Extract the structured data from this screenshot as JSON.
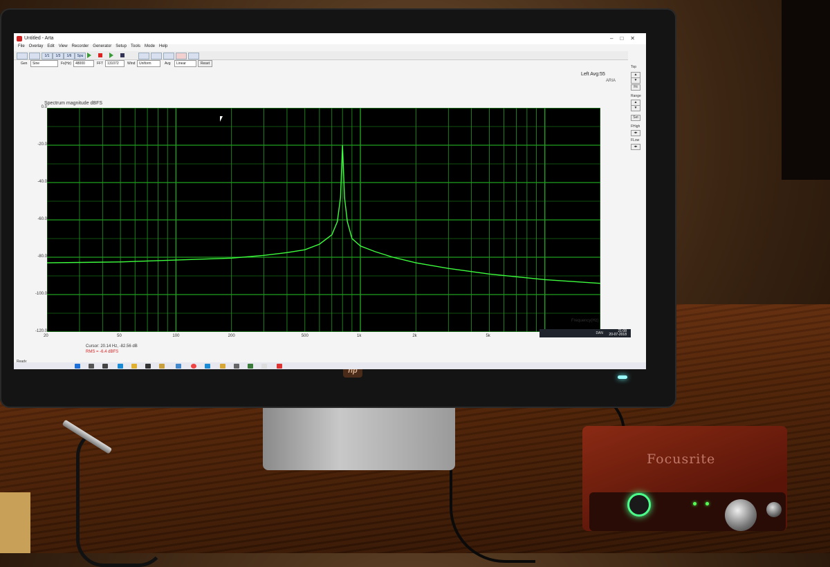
{
  "window": {
    "title": "Untitled - Arta"
  },
  "menu": [
    "File",
    "Overlay",
    "Edit",
    "View",
    "Recorder",
    "Generator",
    "Setup",
    "Tools",
    "Mode",
    "Help"
  ],
  "toolbar": {
    "btn1": "1/1",
    "btn2": "1/3",
    "btn3": "1/6",
    "btn4": "Spu"
  },
  "settings": {
    "gen_label": "Gen",
    "gen_value": "Sine",
    "fs_label": "Fs(Hz)",
    "fs_value": "48000",
    "fft_label": "FFT",
    "fft_value": "131072",
    "wind_label": "Wind",
    "wind_value": "Uniform",
    "avg_label": "Avg",
    "avg_value": "Linear",
    "reset_label": "Reset"
  },
  "channel_info": "Left  Avg:55",
  "aria_text": "ARIA",
  "side_panel": {
    "top_label": "Top",
    "fit_label": "Fit",
    "range_label": "Range",
    "set_label": "Set",
    "fhigh_label": "FHigh",
    "flow_label": "FLow"
  },
  "plot": {
    "title": "Spectrum magnitude dBFS",
    "x_axis_title": "Frequency(Hz)",
    "y_tick_labels": [
      "0.0",
      "-20.0",
      "-40.0",
      "-60.0",
      "-80.0",
      "-100.0",
      "-120.0"
    ],
    "x_tick_labels": [
      "20",
      "50",
      "100",
      "200",
      "500",
      "1k",
      "2k",
      "5k",
      "10k",
      "20k"
    ]
  },
  "status": {
    "cursor": "Cursor: 20.14 Hz, -82.56 dB",
    "rms": "RMS =   -6.4 dBFS",
    "ready": "Ready"
  },
  "tray": {
    "time": "21:08",
    "date": "20-07-2018",
    "lang": "DAN"
  },
  "hardware": {
    "monitor_brand": "hp",
    "interface_brand": "Focusrite"
  },
  "colors": {
    "trace": "#3dff3d",
    "grid": "#1fa01f",
    "plot_bg": "#000000",
    "rms_text": "#dd2222"
  },
  "chart_data": {
    "type": "line",
    "title": "Spectrum magnitude dBFS",
    "xlabel": "Frequency(Hz)",
    "ylabel": "",
    "x_scale": "log",
    "xlim": [
      20,
      20000
    ],
    "ylim": [
      -120,
      0
    ],
    "grid": true,
    "series": [
      {
        "x": [
          20,
          50,
          100,
          200,
          300,
          400,
          500,
          600,
          700,
          750,
          780,
          800,
          820,
          850,
          900,
          1000,
          1200,
          1500,
          2000,
          3000,
          5000,
          10000,
          20000
        ],
        "y": [
          -83,
          -82.5,
          -81.5,
          -80.5,
          -79,
          -77.5,
          -76,
          -73,
          -68,
          -61,
          -48,
          -20,
          -48,
          -61,
          -70,
          -74,
          -77,
          -80,
          -83,
          -86,
          -89,
          -92,
          -94
        ]
      }
    ]
  }
}
